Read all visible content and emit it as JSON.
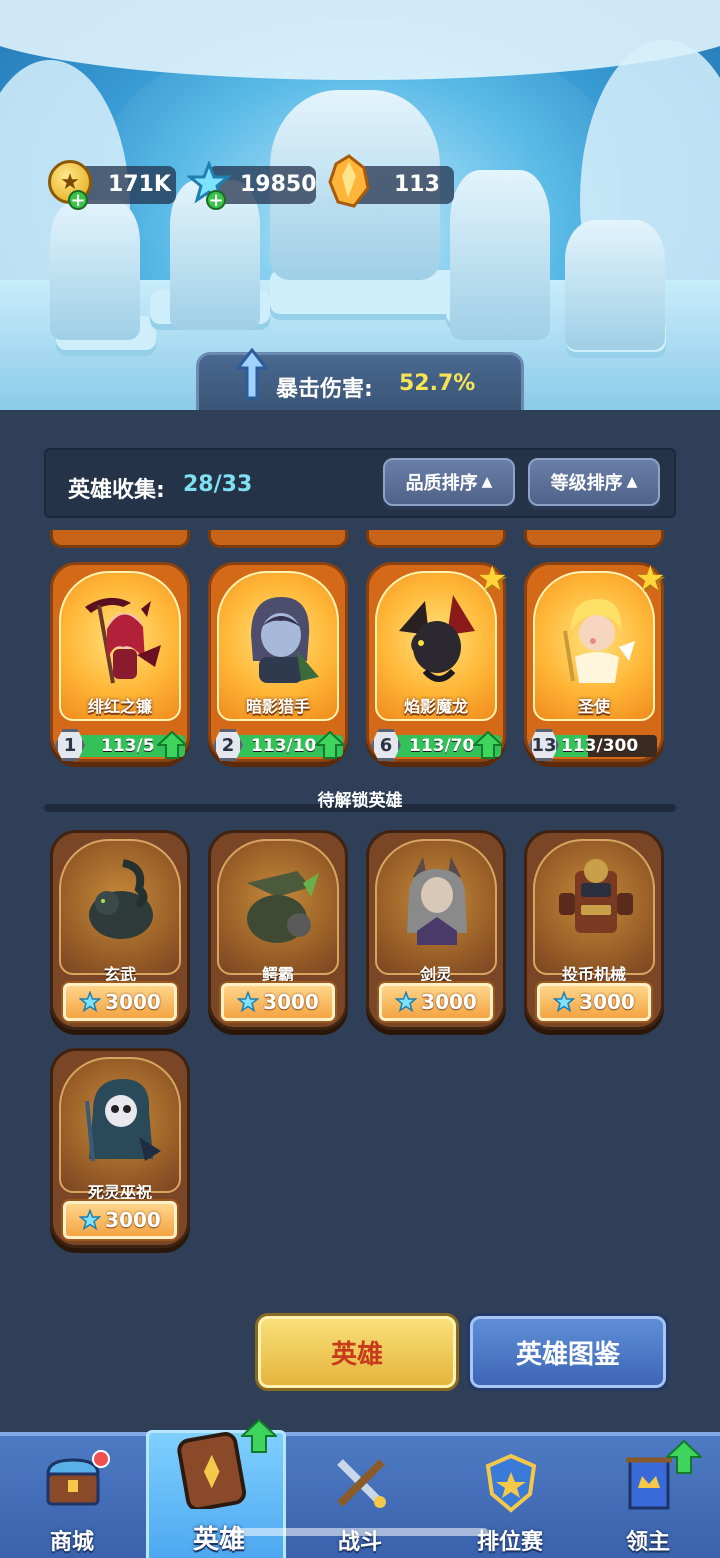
{
  "resources": {
    "gold": "171K",
    "gems": "19850",
    "crystals": "113"
  },
  "crit": {
    "label": "暴击伤害:",
    "value": "52.7%"
  },
  "collection": {
    "label": "英雄收集:",
    "value": "28/33",
    "sort_quality": "品质排序",
    "sort_level": "等级排序"
  },
  "owned_heroes": [
    {
      "name": "绯红之镰",
      "level": "1",
      "progress": "113/5",
      "progress_fraction": 1.0,
      "upgrade": true,
      "star": false
    },
    {
      "name": "暗影猎手",
      "level": "2",
      "progress": "113/10",
      "progress_fraction": 1.0,
      "upgrade": true,
      "star": false
    },
    {
      "name": "焰影魔龙",
      "level": "6",
      "progress": "113/70",
      "progress_fraction": 1.0,
      "upgrade": true,
      "star": true
    },
    {
      "name": "圣使",
      "level": "13",
      "progress": "113/300",
      "progress_fraction": 0.38,
      "upgrade": false,
      "star": true
    }
  ],
  "locked_section": {
    "title": "待解锁英雄"
  },
  "locked_heroes": [
    {
      "name": "玄武",
      "price": "3000"
    },
    {
      "name": "鳄霸",
      "price": "3000"
    },
    {
      "name": "剑灵",
      "price": "3000"
    },
    {
      "name": "投币机械",
      "price": "3000"
    },
    {
      "name": "死灵巫祝",
      "price": "3000"
    }
  ],
  "actions": {
    "hero": "英雄",
    "codex": "英雄图鉴"
  },
  "nav": {
    "shop": "商城",
    "hero": "英雄",
    "battle": "战斗",
    "ranked": "排位赛",
    "lord": "领主"
  },
  "colors": {
    "accent_yellow": "#f7e455",
    "accent_cyan": "#7ee0f0",
    "progress_green": "#33c25a",
    "nav_blue": "#3a62ad"
  }
}
